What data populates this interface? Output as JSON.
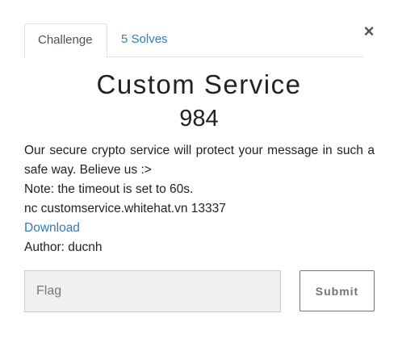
{
  "tabs": [
    {
      "label": "Challenge"
    },
    {
      "label": "5 Solves"
    }
  ],
  "close_label": "×",
  "challenge": {
    "name": "Custom Service",
    "value": "984",
    "description": [
      "Our secure crypto service will protect your message in such a safe way. Believe us :>",
      "Note: the timeout is set to 60s.",
      "nc customservice.whitehat.vn 13337"
    ],
    "download_label": "Download",
    "author": "Author: ducnh"
  },
  "form": {
    "flag_placeholder": "Flag",
    "flag_value": "",
    "submit_label": "Submit"
  }
}
